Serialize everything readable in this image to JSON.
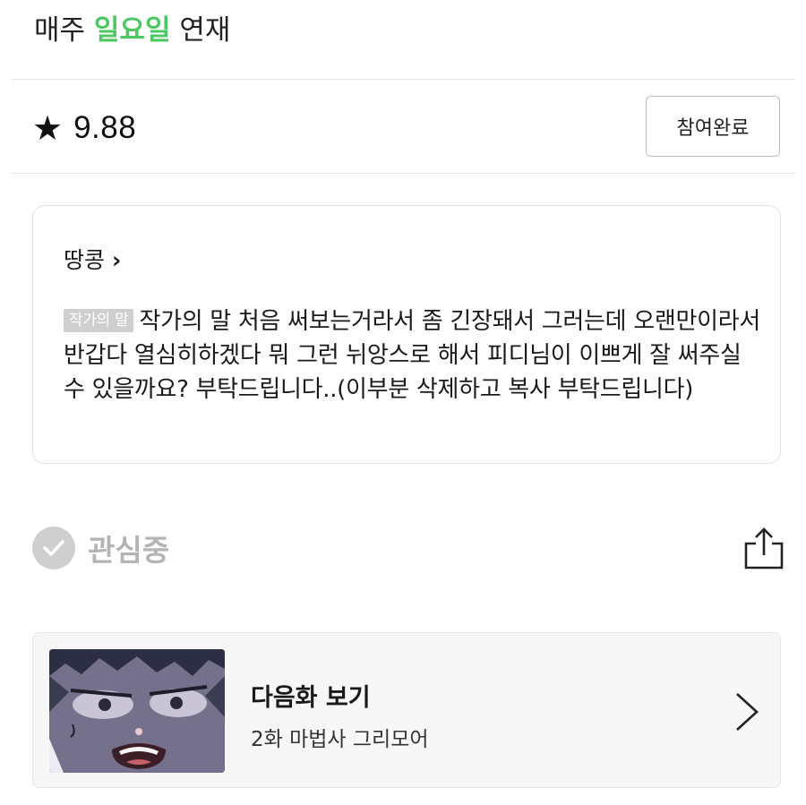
{
  "schedule": {
    "prefix": "매주",
    "day": "일요일",
    "suffix": "연재"
  },
  "rating": {
    "icon": "star-icon",
    "score": "9.88"
  },
  "vote_button": {
    "label": "참여완료"
  },
  "author": {
    "name": "땅콩",
    "chevron": "›",
    "badge": "작가의 말",
    "note": "작가의 말 처음 써보는거라서 좀 긴장돼서 그러는데 오랜만이라서 반갑다 열심히하겠다 뭐 그런 뉘앙스로 해서 피디님이 이쁘게 잘 써주실수 있을까요? 부탁드립니다..(이부분 삭제하고 복사 부탁드립니다)"
  },
  "interest": {
    "icon": "check-circle-icon",
    "label": "관심중"
  },
  "share": {
    "icon": "share-icon"
  },
  "next_episode": {
    "title": "다음화 보기",
    "subtitle": "2화 마법사 그리모어",
    "icon": "chevron-right-icon"
  },
  "colors": {
    "accent_green": "#4cc764",
    "muted_gray": "#b4b4b4",
    "badge_gray": "#cfcfcf"
  }
}
